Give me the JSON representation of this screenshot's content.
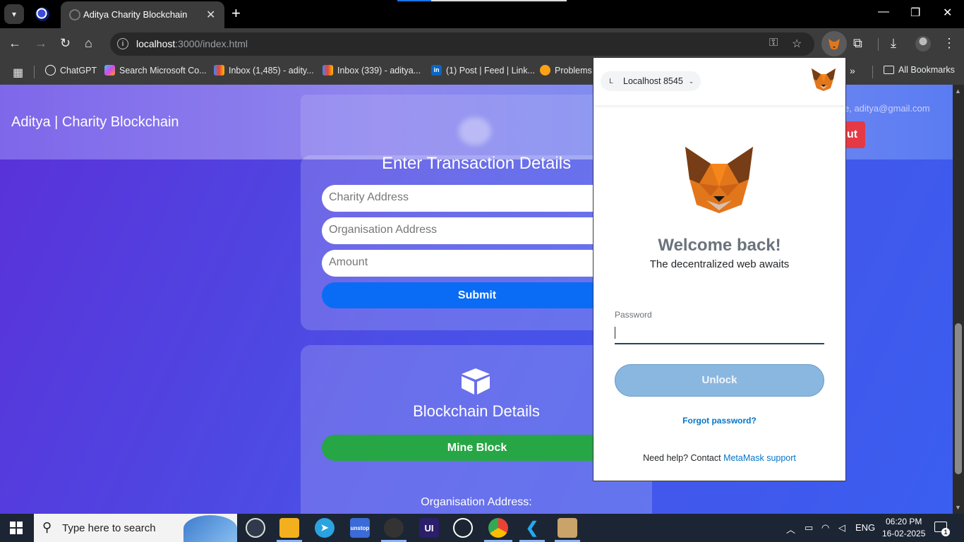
{
  "browser": {
    "tab_title": "Aditya Charity Blockchain",
    "address_host": "localhost",
    "address_path": ":3000/index.html",
    "bookmarks": [
      {
        "label": "ChatGPT",
        "color": "#ffffff"
      },
      {
        "label": "Search Microsoft Co...",
        "color": "#d946ef"
      },
      {
        "label": "Inbox (1,485) - adity...",
        "color": "#ea4335"
      },
      {
        "label": "Inbox (339) - aditya...",
        "color": "#ea4335"
      },
      {
        "label": "(1) Post | Feed | Link...",
        "color": "#0a66c2"
      },
      {
        "label": "Problems",
        "color": "#ffa116"
      }
    ],
    "all_bookmarks": "All Bookmarks"
  },
  "site": {
    "title": "Aditya | Charity Blockchain",
    "welcome": "e, aditya@gmail.com",
    "logout_partial": "ut",
    "transaction": {
      "heading": "Enter Transaction Details",
      "charity_placeholder": "Charity Address",
      "organisation_placeholder": "Organisation Address",
      "amount_placeholder": "Amount",
      "submit": "Submit"
    },
    "blockchain": {
      "heading": "Blockchain Details",
      "mine": "Mine Block",
      "org_label": "Organisation Address:"
    }
  },
  "metamask": {
    "network_initial": "L",
    "network": "Localhost 8545",
    "welcome": "Welcome back!",
    "subtitle": "The decentralized web awaits",
    "password_label": "Password",
    "unlock": "Unlock",
    "forgot": "Forgot password?",
    "help_prefix": "Need help? Contact ",
    "help_link": "MetaMask support"
  },
  "taskbar": {
    "search_placeholder": "Type here to search",
    "language": "ENG",
    "time": "06:20 PM",
    "date": "16-02-2025",
    "notification_count": "1",
    "apps": [
      {
        "name": "clock-app-icon",
        "label": "",
        "color": "#2f3a4a"
      },
      {
        "name": "file-explorer-icon",
        "label": "",
        "color": "#f2b01e"
      },
      {
        "name": "telegram-icon",
        "label": "",
        "color": "#2aa3df"
      },
      {
        "name": "unstop-icon",
        "label": "unstop",
        "color": "#3a6bd8"
      },
      {
        "name": "github-desktop-icon",
        "label": "",
        "color": "#333333"
      },
      {
        "name": "ui-app-icon",
        "label": "UI",
        "color": "#2b1f6b"
      },
      {
        "name": "chatgpt-icon",
        "label": "",
        "color": "#1c2533"
      },
      {
        "name": "chrome-icon",
        "label": "",
        "color": "#1c2533"
      },
      {
        "name": "vscode-icon",
        "label": "",
        "color": "#1c2533"
      },
      {
        "name": "virtualbox-icon",
        "label": "",
        "color": "#c9a36a"
      }
    ]
  }
}
